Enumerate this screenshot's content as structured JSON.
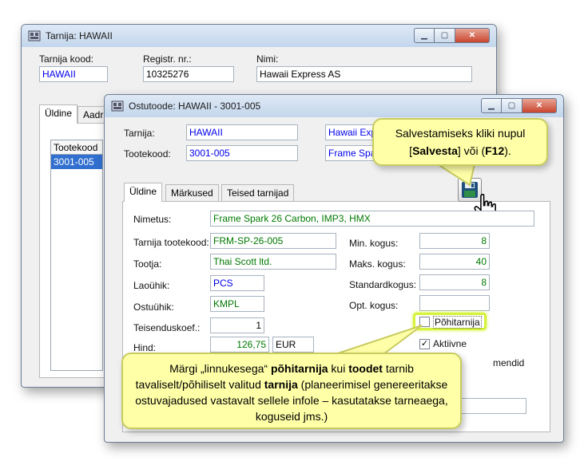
{
  "back_window": {
    "title": "Tarnija: HAWAII",
    "supplier_code_label": "Tarnija kood:",
    "supplier_code_value": "HAWAII",
    "reg_nr_label": "Registr. nr.:",
    "reg_nr_value": "10325276",
    "name_label": "Nimi:",
    "name_value": "Hawaii Express AS",
    "tabs": [
      "Üldine",
      "Aadr"
    ],
    "list_header": "Tootekood",
    "list_rows": [
      "3001-005"
    ]
  },
  "front_window": {
    "title": "Ostutoode: HAWAII - 3001-005",
    "supplier_label": "Tarnija:",
    "supplier_value": "HAWAII",
    "supplier_name": "Hawaii Exp",
    "product_code_label": "Tootekood:",
    "product_code_value": "3001-005",
    "product_name_short": "Frame Spar",
    "tabs": [
      "Üldine",
      "Märkused",
      "Teised tarnijad"
    ],
    "name_label": "Nimetus:",
    "name_value": "Frame Spark 26 Carbon, IMP3, HMX",
    "supplier_product_code_label": "Tarnija tootekood:",
    "supplier_product_code_value": "FRM-SP-26-005",
    "manufacturer_label": "Tootja:",
    "manufacturer_value": "Thai Scott ltd.",
    "stock_unit_label": "Laoühik:",
    "stock_unit_value": "PCS",
    "purchase_unit_label": "Ostuühik:",
    "purchase_unit_value": "KMPL",
    "conversion_label": "Teisenduskoef.:",
    "conversion_value": "1",
    "price_label": "Hind:",
    "price_value": "126,75",
    "currency_value": "EUR",
    "min_qty_label": "Min. kogus:",
    "min_qty_value": "8",
    "max_qty_label": "Maks. kogus:",
    "max_qty_value": "40",
    "std_qty_label": "Standardkogus:",
    "std_qty_value": "8",
    "opt_qty_label": "Opt. kogus:",
    "opt_qty_value": "",
    "main_supplier_label": "Põhitarnija",
    "main_supplier_checked": false,
    "active_label": "Aktiivne",
    "active_checked": true,
    "partial_label": "mendid"
  },
  "callouts": {
    "save_line1": "Salvestamiseks kliki nupul",
    "save_bracket_open": "[",
    "save_bold1": "Salvesta",
    "save_mid": "] või (",
    "save_bold2": "F12",
    "save_close": ").",
    "main_part1": "Märgi „linnukesega“ ",
    "main_bold1": "põhitarnija",
    "main_part2": " kui ",
    "main_bold2": "toodet",
    "main_part3": " tarnib tavaliselt/põhiliselt valitud ",
    "main_bold3": "tarnija",
    "main_part4": " (planeerimisel genereeritakse ostuvajadused vastavalt sellele infole – kasutatakse tarneaega, koguseid jms.)"
  },
  "colors": {
    "callout_bg": "#ffffa8",
    "highlight": "#d6f23a",
    "field_blue": "#0000ee",
    "field_green": "#007a00"
  }
}
